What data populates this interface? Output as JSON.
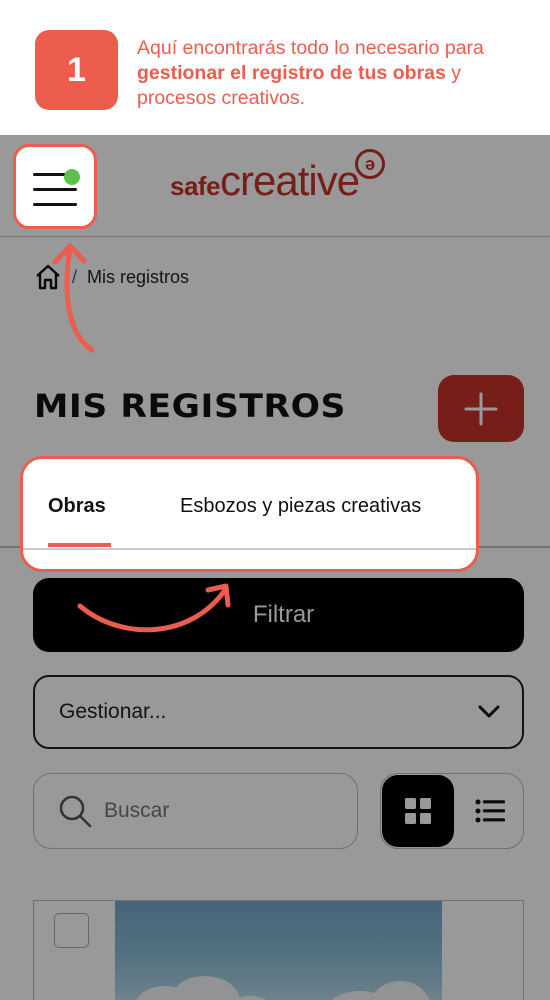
{
  "tutorial": {
    "step_number": "1",
    "text_intro": "Aquí encontrarás todo lo necesario para ",
    "text_bold": "gestionar el registro de tus obras",
    "text_outro": " y procesos creativos.",
    "accent_color": "#ec5d4e"
  },
  "header": {
    "menu_icon": "hamburger-menu-icon",
    "logo_prefix": "safe",
    "logo_main": "creative",
    "logo_mark": "ə",
    "brand_color": "#c8322a",
    "notification_color": "#5cc24a"
  },
  "breadcrumb": {
    "home_icon": "home-icon",
    "separator": "/",
    "current": "Mis registros"
  },
  "page": {
    "title": "MIS REGISTROS",
    "add_icon": "plus-icon"
  },
  "tabs": [
    {
      "label": "Obras",
      "active": true
    },
    {
      "label": "Esbozos y piezas creativas",
      "active": false
    }
  ],
  "filter": {
    "label": "Filtrar"
  },
  "manage": {
    "value": "Gestionar...",
    "icon": "chevron-down-icon"
  },
  "search": {
    "placeholder": "Buscar",
    "icon": "search-icon"
  },
  "view_toggle": {
    "grid_icon": "grid-view-icon",
    "list_icon": "list-view-icon",
    "selected": "grid"
  }
}
